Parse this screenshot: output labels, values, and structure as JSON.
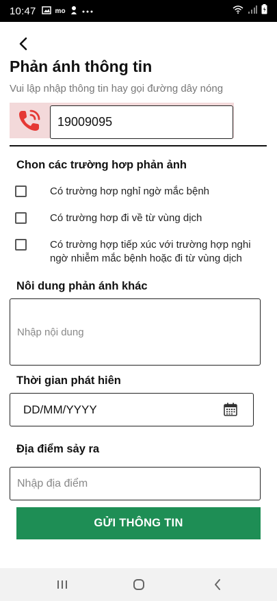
{
  "status_bar": {
    "time": "10:47",
    "mode_label": "mo"
  },
  "header": {
    "title": "Phản ánh thông tin",
    "subtitle": "Vui lập nhập thông tin hay gọi đường dây nóng"
  },
  "hotline": {
    "number": "19009095",
    "accent_color": "#e53935"
  },
  "cases": {
    "title": "Chon các trường hơp phản ảnh",
    "items": [
      {
        "label": "Có trường hơp nghỉ ngờ mắc bệnh",
        "checked": false
      },
      {
        "label": "Có trường hơp đi về từ vùng dịch",
        "checked": false
      },
      {
        "label": "Có trường hợp tiếp xúc với trường hợp nghi ngờ nhiễm mắc bệnh hoặc đi từ vùng dịch",
        "checked": false
      }
    ]
  },
  "other_content": {
    "title": "Nôi dung phản ánh khác",
    "placeholder": "Nhập nội dung"
  },
  "detection_time": {
    "title": "Thời gian phát hiên",
    "value": "DD/MM/YYYY"
  },
  "location": {
    "title": "Địa điểm sảy ra",
    "placeholder": "Nhập địa điểm"
  },
  "submit": {
    "label": "GỬI THÔNG TIN",
    "color": "#1e8e55"
  }
}
